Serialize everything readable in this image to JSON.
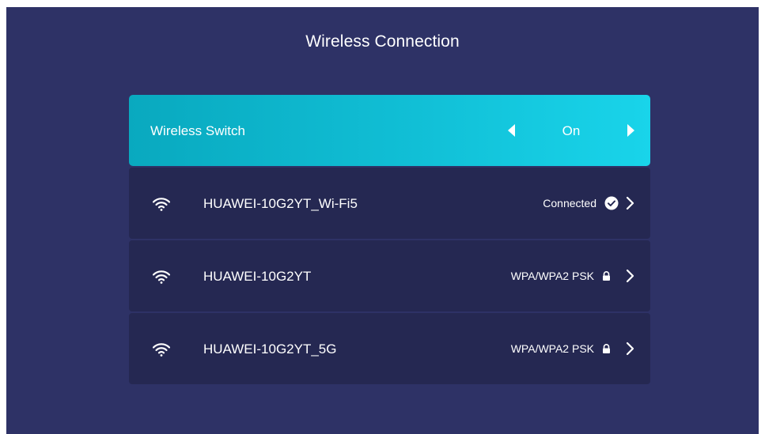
{
  "header": {
    "title": "Wireless Connection"
  },
  "wireless_switch": {
    "label": "Wireless Switch",
    "value": "On"
  },
  "networks": [
    {
      "ssid": "HUAWEI-10G2YT_Wi-Fi5",
      "status": "Connected",
      "status_icon": "check-circle-icon"
    },
    {
      "ssid": "HUAWEI-10G2YT",
      "status": "WPA/WPA2 PSK",
      "status_icon": "lock-icon"
    },
    {
      "ssid": "HUAWEI-10G2YT_5G",
      "status": "WPA/WPA2 PSK",
      "status_icon": "lock-icon"
    }
  ],
  "colors": {
    "background": "#2e3266",
    "row_background": "#252852",
    "accent_start": "#09a9bf",
    "accent_end": "#19d4ea"
  }
}
